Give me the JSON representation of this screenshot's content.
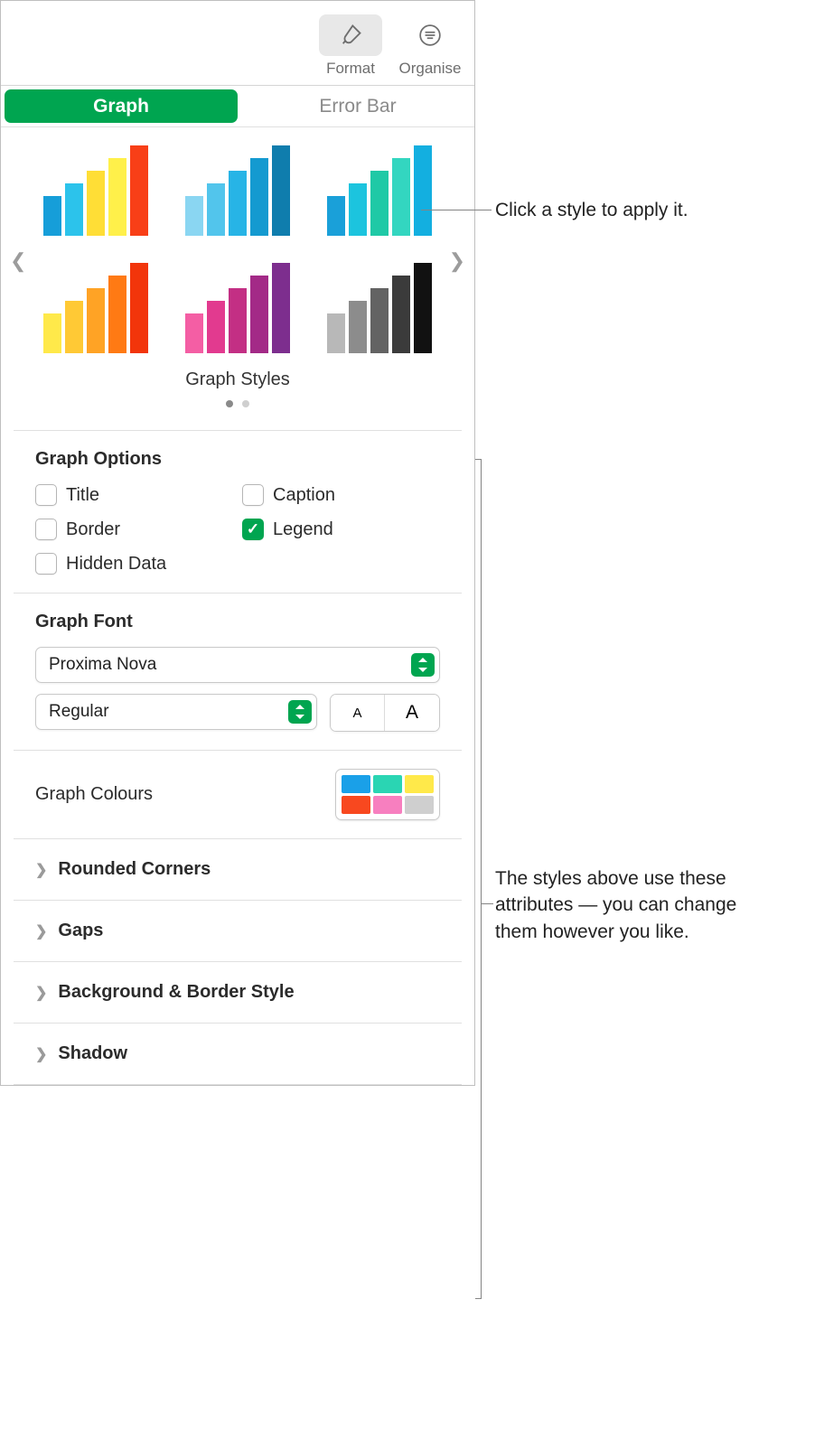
{
  "toolbar": {
    "format": "Format",
    "organise": "Organise"
  },
  "tabs": {
    "graph": "Graph",
    "errorbar": "Error Bar"
  },
  "styles": {
    "label": "Graph Styles",
    "thumbs": [
      {
        "colors": [
          "#169ed9",
          "#2cc3eb",
          "#ffde36",
          "#fff04a",
          "#f83f17"
        ],
        "heights": [
          44,
          58,
          72,
          86,
          100
        ]
      },
      {
        "colors": [
          "#8ad6f2",
          "#52c5ec",
          "#27b4e6",
          "#149ad0",
          "#0f7dad"
        ],
        "heights": [
          44,
          58,
          72,
          86,
          100
        ]
      },
      {
        "colors": [
          "#1aa0d9",
          "#1cc4de",
          "#1fc9a6",
          "#33d6c0",
          "#13afe0"
        ],
        "heights": [
          44,
          58,
          72,
          86,
          100
        ]
      },
      {
        "colors": [
          "#ffe94a",
          "#ffc935",
          "#ffa325",
          "#ff7a14",
          "#f2350b"
        ],
        "heights": [
          44,
          58,
          72,
          86,
          100
        ]
      },
      {
        "colors": [
          "#f45ea4",
          "#e23a8f",
          "#c32f84",
          "#a32a87",
          "#7d2e8e"
        ],
        "heights": [
          44,
          58,
          72,
          86,
          100
        ]
      },
      {
        "colors": [
          "#b8b8b8",
          "#8c8c8c",
          "#636363",
          "#3b3b3b",
          "#111111"
        ],
        "heights": [
          44,
          58,
          72,
          86,
          100
        ]
      }
    ]
  },
  "options": {
    "heading": "Graph Options",
    "title": {
      "label": "Title",
      "checked": false
    },
    "caption": {
      "label": "Caption",
      "checked": false
    },
    "border": {
      "label": "Border",
      "checked": false
    },
    "legend": {
      "label": "Legend",
      "checked": true
    },
    "hidden": {
      "label": "Hidden Data",
      "checked": false
    }
  },
  "font": {
    "heading": "Graph Font",
    "family": "Proxima Nova",
    "weight": "Regular",
    "smallA": "A",
    "bigA": "A"
  },
  "colours": {
    "heading": "Graph Colours",
    "swatches": [
      "#1aa0e8",
      "#2ad5b3",
      "#ffe94a",
      "#f8481f",
      "#f77fbf",
      "#cfcfcf"
    ]
  },
  "disclosures": {
    "rounded": "Rounded Corners",
    "gaps": "Gaps",
    "bgborder": "Background & Border Style",
    "shadow": "Shadow"
  },
  "callouts": {
    "top": "Click a style to apply it.",
    "side": "The styles above use these attributes — you can change them however you like."
  }
}
